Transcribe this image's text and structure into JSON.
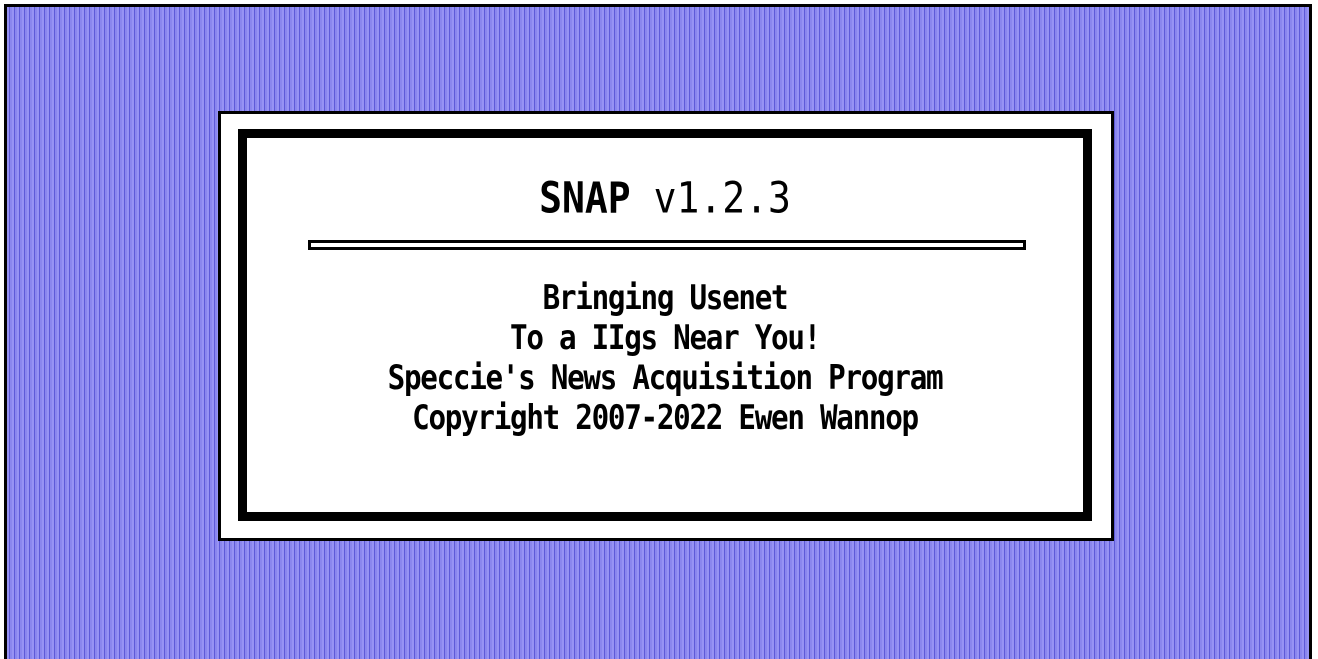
{
  "splash": {
    "app_name": "SNAP",
    "version": "v1.2.3",
    "lines": [
      "Bringing Usenet",
      "To a IIgs Near You!",
      "Speccie's News Acquisition Program",
      "Copyright 2007-2022 Ewen Wannop"
    ]
  },
  "colors": {
    "desktop_pattern": "#8a86ee",
    "desktop_stripe_dark": "#5e5ad8",
    "dialog_background": "#ffffff",
    "dialog_border": "#000000"
  }
}
